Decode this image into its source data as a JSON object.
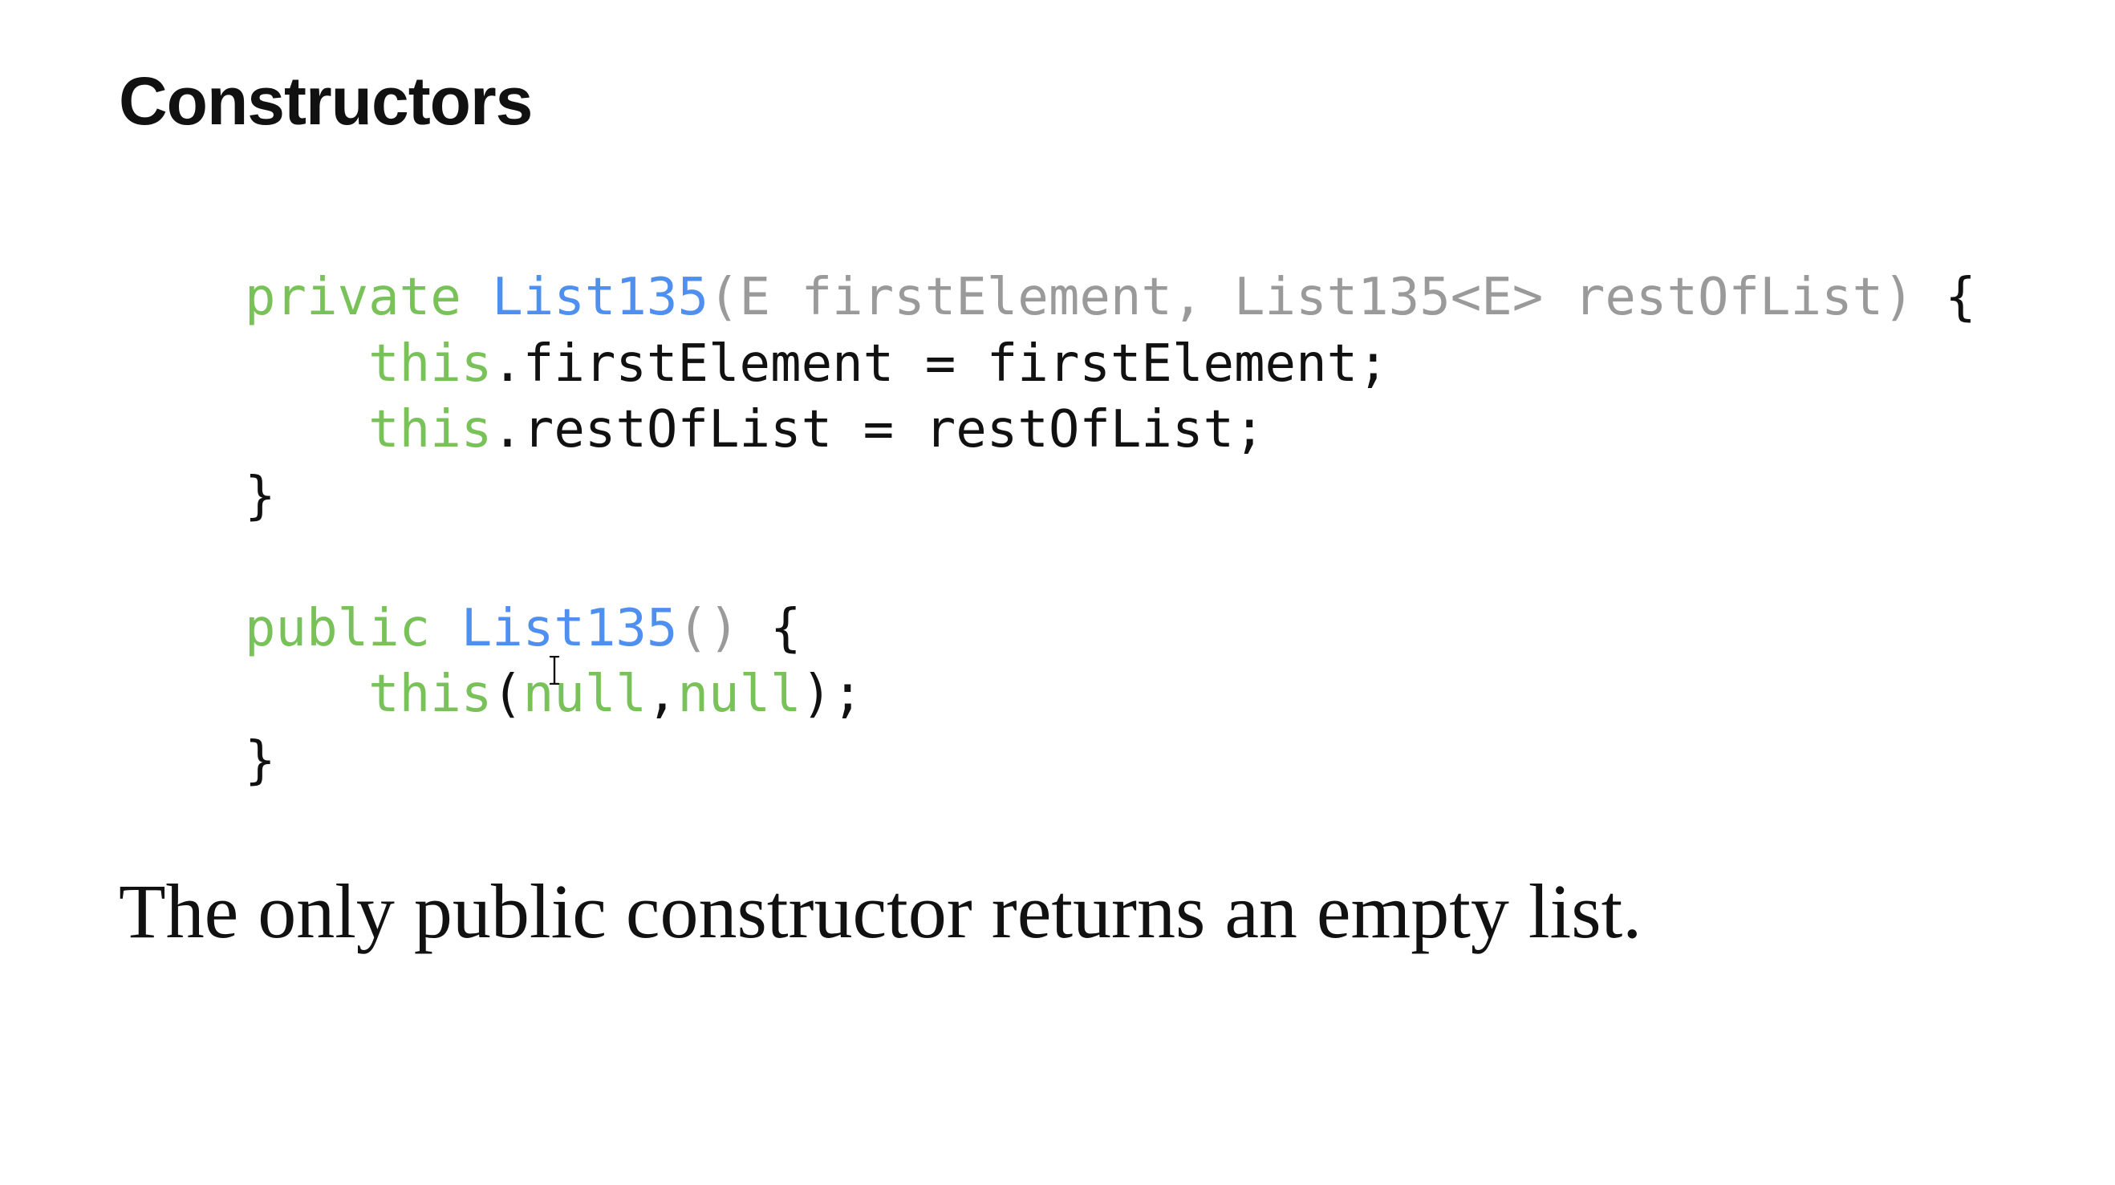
{
  "slide": {
    "title": "Constructors",
    "code": {
      "lines": [
        [
          {
            "t": "private ",
            "s": "kw"
          },
          {
            "t": "List135",
            "s": "fn"
          },
          {
            "t": "(E firstElement, List135<E> restOfList)",
            "s": "pm"
          },
          {
            "t": " {",
            "s": "pl"
          }
        ],
        [
          {
            "t": "    ",
            "s": "pl"
          },
          {
            "t": "this",
            "s": "kw"
          },
          {
            "t": ".firstElement = firstElement;",
            "s": "pl"
          }
        ],
        [
          {
            "t": "    ",
            "s": "pl"
          },
          {
            "t": "this",
            "s": "kw"
          },
          {
            "t": ".restOfList = restOfList;",
            "s": "pl"
          }
        ],
        [
          {
            "t": "}",
            "s": "pl"
          }
        ],
        [
          {
            "t": "",
            "s": "pl"
          }
        ],
        [
          {
            "t": "public ",
            "s": "kw"
          },
          {
            "t": "List135",
            "s": "fn"
          },
          {
            "t": "()",
            "s": "pm"
          },
          {
            "t": " {",
            "s": "pl"
          }
        ],
        [
          {
            "t": "    ",
            "s": "pl"
          },
          {
            "t": "this",
            "s": "kw"
          },
          {
            "t": "(",
            "s": "pl"
          },
          {
            "t": "null",
            "s": "kw"
          },
          {
            "t": ",",
            "s": "pl"
          },
          {
            "t": "null",
            "s": "kw"
          },
          {
            "t": ");",
            "s": "pl"
          }
        ],
        [
          {
            "t": "}",
            "s": "pl"
          }
        ]
      ]
    },
    "caption": "The only public constructor returns an empty list."
  },
  "colors": {
    "keyword": "#79c25a",
    "type_name": "#4f8ff0",
    "params": "#9a9a9a",
    "plain": "#111111",
    "background": "#ffffff"
  },
  "icons": {
    "cursor": "i-beam-cursor-icon"
  }
}
